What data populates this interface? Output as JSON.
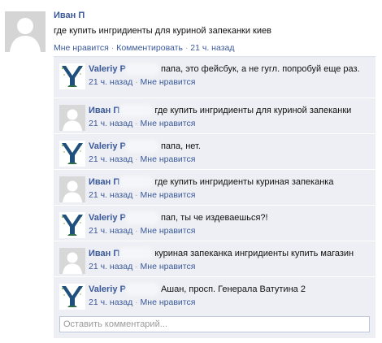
{
  "post": {
    "author": "Иван П",
    "text": "где купить ингридиенты для куриной запеканки киев",
    "like_label": "Мне нравится",
    "comment_label": "Комментировать",
    "time": "21 ч. назад",
    "separator": "·"
  },
  "comments": [
    {
      "author": "Valeriy P",
      "avatar": "tree-logo",
      "text": "папа, это фейсбук, а не гугл. попробуй еще раз.",
      "time": "21 ч. назад",
      "like": "Мне нравится"
    },
    {
      "author": "Иван П",
      "avatar": "person",
      "text": "где купить ингридиенты для куриной запеканки",
      "time": "21 ч. назад",
      "like": "Мне нравится"
    },
    {
      "author": "Valeriy P",
      "avatar": "tree-logo",
      "text": "папа, нет.",
      "time": "21 ч. назад",
      "like": "Мне нравится"
    },
    {
      "author": "Иван П",
      "avatar": "person",
      "text": "где купить ингридиенты куриная запеканка",
      "time": "21 ч. назад",
      "like": "Мне нравится"
    },
    {
      "author": "Valeriy P",
      "avatar": "tree-logo",
      "text": "пап, ты че издеваешься?!",
      "time": "21 ч. назад",
      "like": "Мне нравится"
    },
    {
      "author": "Иван П",
      "avatar": "person",
      "text": "куриная запеканка ингридиенты купить магазин",
      "time": "21 ч. назад",
      "like": "Мне нравится"
    },
    {
      "author": "Valeriy P",
      "avatar": "tree-logo",
      "text": "Ашан, просп. Генерала Ватутина 2",
      "time": "21 ч. назад",
      "like": "Мне нравится"
    }
  ],
  "reply": {
    "placeholder": "Оставить комментарий..."
  },
  "colors": {
    "link": "#3b5998",
    "comment_bg": "#edeff4",
    "meta": "#808080"
  }
}
